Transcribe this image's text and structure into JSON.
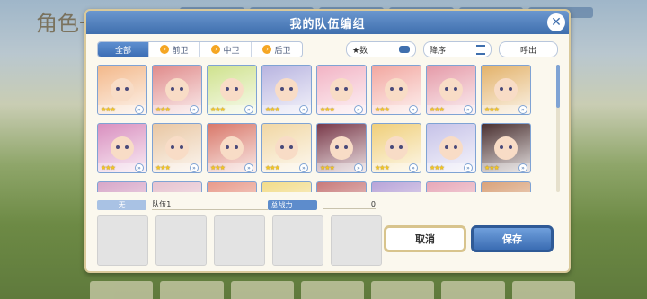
{
  "background": {
    "title": "角色一览"
  },
  "dialog": {
    "title": "我的队伍编组",
    "close_icon": "close-icon"
  },
  "filters": {
    "tabs": [
      {
        "label": "全部",
        "active": true
      },
      {
        "label": "前卫",
        "active": false
      },
      {
        "label": "中卫",
        "active": false
      },
      {
        "label": "后卫",
        "active": false
      }
    ],
    "star_label": "★数",
    "sort_label": "降序",
    "call_label": "呼出"
  },
  "characters": [
    {
      "stars": "★★★",
      "color": "#f3b88a"
    },
    {
      "stars": "★★★",
      "color": "#e08b8b"
    },
    {
      "stars": "★★★",
      "color": "#cfe28d"
    },
    {
      "stars": "★★★",
      "color": "#b8b4e0"
    },
    {
      "stars": "★★★",
      "color": "#f2b3c4"
    },
    {
      "stars": "★★★",
      "color": "#f2a7a0"
    },
    {
      "stars": "★★★",
      "color": "#e59aa8"
    },
    {
      "stars": "★★★",
      "color": "#e3b26a"
    },
    {
      "stars": "★★★",
      "color": "#d98fbf"
    },
    {
      "stars": "★★★",
      "color": "#e9c7a3"
    },
    {
      "stars": "★★★",
      "color": "#d9786a"
    },
    {
      "stars": "★★★",
      "color": "#f1d7a4"
    },
    {
      "stars": "★★★",
      "color": "#7a3a4a"
    },
    {
      "stars": "★★★",
      "color": "#f0cf7a"
    },
    {
      "stars": "★★★",
      "color": "#c6c2e8"
    },
    {
      "stars": "★★★",
      "color": "#4a3030"
    },
    {
      "stars": "",
      "color": "#d7a6c8"
    },
    {
      "stars": "",
      "color": "#e6c2cf"
    },
    {
      "stars": "",
      "color": "#e89a8a"
    },
    {
      "stars": "",
      "color": "#f2dc8a"
    },
    {
      "stars": "",
      "color": "#c87a7a"
    },
    {
      "stars": "",
      "color": "#b8a4d8"
    },
    {
      "stars": "",
      "color": "#e7a8b8"
    },
    {
      "stars": "",
      "color": "#d9a27a"
    }
  ],
  "team": {
    "none_tag": "无",
    "name": "队伍1",
    "power_label": "总战力",
    "power_value": "0"
  },
  "buttons": {
    "cancel": "取消",
    "save": "保存"
  }
}
